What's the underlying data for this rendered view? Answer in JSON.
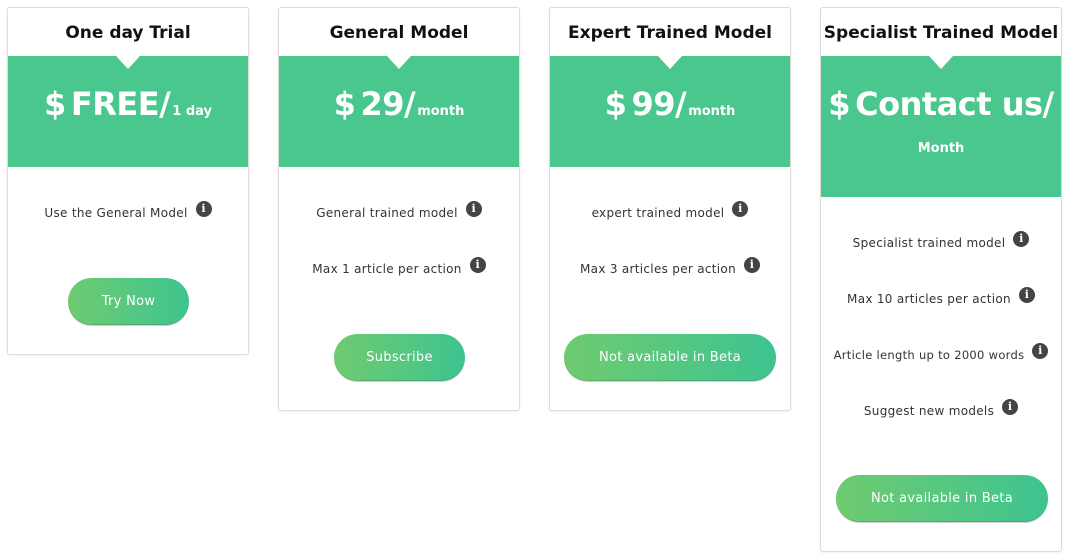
{
  "plans": [
    {
      "title": "One day Trial",
      "currency": "$",
      "price": "FREE/",
      "unit": "1 day",
      "features": [
        {
          "text": "Use the General Model",
          "icon": "info-icon"
        }
      ],
      "cta": "Try Now"
    },
    {
      "title": "General Model",
      "currency": "$",
      "price": "29/",
      "unit": "month",
      "features": [
        {
          "text": "General trained model",
          "icon": "info-icon"
        },
        {
          "text": "Max 1 article per action",
          "icon": "info-icon"
        }
      ],
      "cta": "Subscribe"
    },
    {
      "title": "Expert Trained Model",
      "currency": "$",
      "price": "99/",
      "unit": "month",
      "features": [
        {
          "text": "expert trained model",
          "icon": "info-icon"
        },
        {
          "text": "Max 3 articles per action",
          "icon": "info-icon"
        }
      ],
      "cta": "Not available in Beta"
    },
    {
      "title": "Specialist Trained Model",
      "currency": "$",
      "price": "Contact us/",
      "unit": "Month",
      "features": [
        {
          "text": "Specialist trained model",
          "icon": "info-icon"
        },
        {
          "text": "Max 10 articles per action",
          "icon": "info-icon"
        },
        {
          "text": "Article length up to 2000 words",
          "icon": "info-icon"
        },
        {
          "text": "Suggest new models",
          "icon": "info-icon"
        }
      ],
      "cta": "Not available in Beta"
    }
  ],
  "info_glyph": "i",
  "colors": {
    "price_band": "#49c78f",
    "button_gradient_start": "#6fcb70",
    "button_gradient_end": "#3ec490",
    "info_icon": "#444444"
  }
}
